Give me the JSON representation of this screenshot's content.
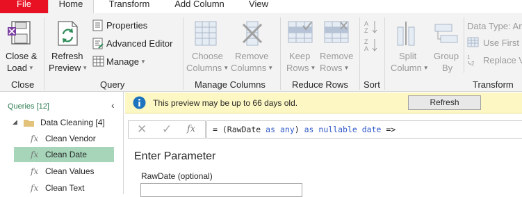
{
  "tabs": [
    "File",
    "Home",
    "Transform",
    "Add Column",
    "View"
  ],
  "ribbon": {
    "close_group": {
      "label": "Close",
      "close_load": [
        "Close &",
        "Load"
      ]
    },
    "query_group": {
      "label": "Query",
      "refresh_preview": [
        "Refresh",
        "Preview"
      ],
      "properties": "Properties",
      "advanced_editor": "Advanced Editor",
      "manage": "Manage"
    },
    "manage_columns_group": {
      "label": "Manage Columns",
      "choose_columns": [
        "Choose",
        "Columns"
      ],
      "remove_columns": [
        "Remove",
        "Columns"
      ]
    },
    "reduce_rows_group": {
      "label": "Reduce Rows",
      "keep_rows": [
        "Keep",
        "Rows"
      ],
      "remove_rows": [
        "Remove",
        "Rows"
      ]
    },
    "sort_group": {
      "label": "Sort"
    },
    "transform_group": {
      "label": "Transform",
      "split_column": [
        "Split",
        "Column"
      ],
      "group_by": [
        "Group",
        "By"
      ],
      "data_type": "Data Type: An",
      "use_first_row": "Use First R",
      "replace_values": "Replace V"
    }
  },
  "queries": {
    "header": "Queries [12]",
    "folder": "Data Cleaning [4]",
    "items": [
      "Clean Vendor",
      "Clean Date",
      "Clean Values",
      "Clean Text"
    ],
    "selected_index": 1
  },
  "infobar": {
    "message": "This preview may be up to 66 days old.",
    "refresh_label": "Refresh"
  },
  "formula": {
    "fx": "fx",
    "text": "= (RawDate as any) as nullable date =>"
  },
  "parameter": {
    "title": "Enter Parameter",
    "field_label": "RawDate (optional)",
    "field_value": ""
  },
  "colors": {
    "file_tab": "#e81123",
    "selected_query": "#a6d5b9",
    "infobar_bg": "#fdf7c3",
    "info_icon": "#1e73be",
    "ribbon_bg": "#f3f3f3"
  }
}
